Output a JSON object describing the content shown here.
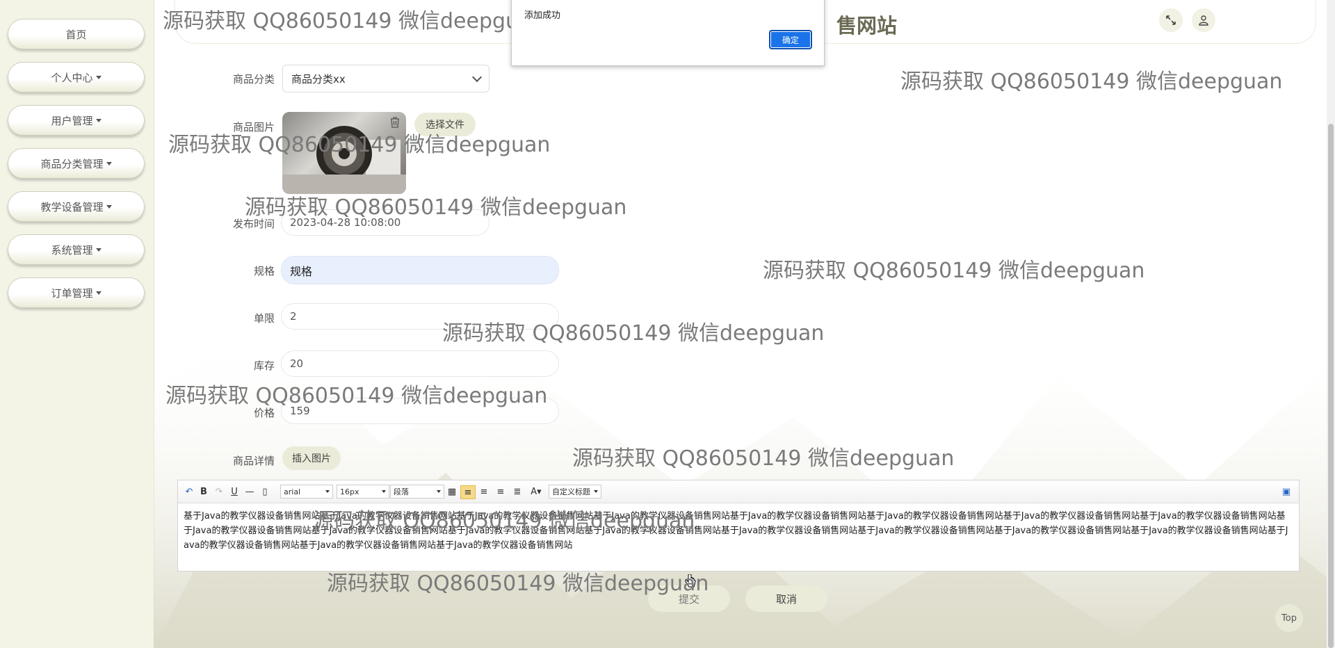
{
  "sidebar": {
    "items": [
      {
        "label": "首页",
        "dropdown": false
      },
      {
        "label": "个人中心",
        "dropdown": true
      },
      {
        "label": "用户管理",
        "dropdown": true
      },
      {
        "label": "商品分类管理",
        "dropdown": true
      },
      {
        "label": "教学设备管理",
        "dropdown": true
      },
      {
        "label": "系统管理",
        "dropdown": true
      },
      {
        "label": "订单管理",
        "dropdown": true
      }
    ]
  },
  "header": {
    "title_visible": "售网站",
    "fullscreen_icon": "expand-icon",
    "user_icon": "user-icon"
  },
  "form": {
    "category": {
      "label": "商品分类",
      "value": "商品分类xx"
    },
    "image": {
      "label": "商品图片",
      "choose_file": "选择文件",
      "delete_icon": "trash-icon"
    },
    "publish_time": {
      "label": "发布时间",
      "value": "2023-04-28 10:08:00"
    },
    "spec": {
      "label": "规格",
      "value": "规格"
    },
    "limit": {
      "label": "单限",
      "value": "2"
    },
    "stock": {
      "label": "库存",
      "value": "20"
    },
    "price": {
      "label": "价格",
      "value": "159"
    },
    "detail": {
      "label": "商品详情",
      "insert_image": "插入图片"
    },
    "submit": "提交",
    "cancel": "取消"
  },
  "editor": {
    "font": "arial",
    "size": "16px",
    "paragraph": "段落",
    "custom_title": "自定义标题",
    "content": "基于Java的教学仪器设备销售网站基于Java的教学仪器设备销售网站基于Java的教学仪器设备销售网站基于Java的教学仪器设备销售网站基于Java的教学仪器设备销售网站基于Java的教学仪器设备销售网站基于Java的教学仪器设备销售网站基于Java的教学仪器设备销售网站基于Java的教学仪器设备销售网站基于Java的教学仪器设备销售网站基于Java的教学仪器设备销售网站基于Java的教学仪器设备销售网站基于Java的教学仪器设备销售网站基于Java的教学仪器设备销售网站基于Java的教学仪器设备销售网站基于Java的教学仪器设备销售网站基于Java的教学仪器设备销售网站基于Java的教学仪器设备销售网站基于Java的教学仪器设备销售网站"
  },
  "dialog": {
    "message": "添加成功",
    "ok": "确定"
  },
  "watermark": "源码获取 QQ86050149 微信deepguan",
  "top_button": "Top",
  "colors": {
    "sidebar_bg": "#f3f3e6",
    "accent": "#1a73e8",
    "pill": "#ebebd9"
  }
}
